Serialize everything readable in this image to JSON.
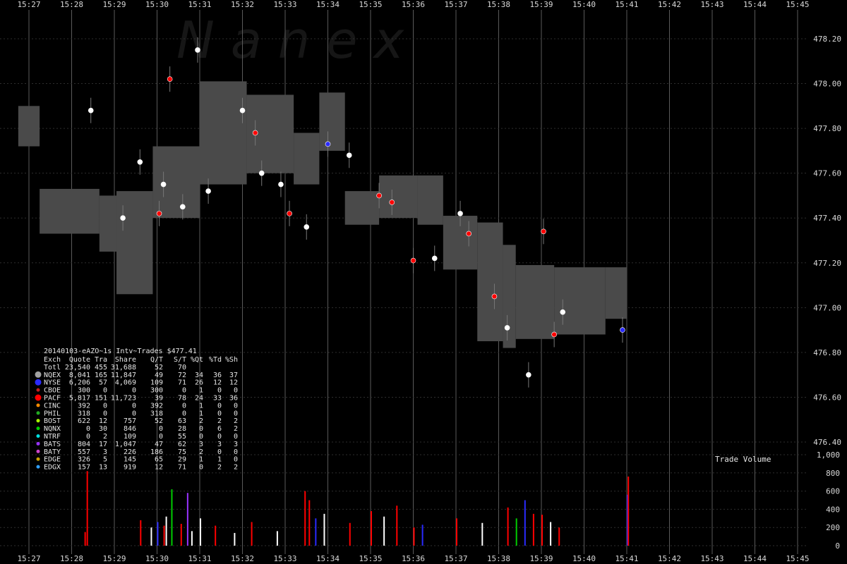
{
  "watermark": "N a n e x",
  "chart_data": {
    "type": "scatter",
    "title": "20140103-eAZO~1s Intv~Trades $477.41",
    "x_ticks": [
      "15:27",
      "15:28",
      "15:29",
      "15:30",
      "15:31",
      "15:32",
      "15:33",
      "15:34",
      "15:35",
      "15:36",
      "15:37",
      "15:38",
      "15:39",
      "15:40",
      "15:41",
      "15:42",
      "15:43",
      "15:44",
      "15:45"
    ],
    "y_ticks": [
      "478.20",
      "478.00",
      "477.80",
      "477.60",
      "477.40",
      "477.20",
      "477.00",
      "476.80",
      "476.60",
      "476.40"
    ],
    "ylim": [
      476.4,
      478.2
    ],
    "volume_label": "Trade Volume",
    "volume_ticks": [
      "1,000",
      "800",
      "600",
      "400",
      "200",
      "0"
    ],
    "volume_ylim": [
      0,
      1000
    ],
    "grid": true,
    "table_header": [
      "Exch",
      "Quote",
      "Tra",
      "Share",
      "Q/T",
      "S/T",
      "%Qt",
      "%Td",
      "%Sh"
    ],
    "table_rows": [
      {
        "exch": "Totl",
        "color": "",
        "quote": "23,540",
        "tra": "455",
        "share": "31,688",
        "qt": "52",
        "st": "70",
        "pq": "",
        "pt": "",
        "ps": ""
      },
      {
        "exch": "NQEX",
        "color": "#a0a0a0",
        "quote": "8,041",
        "tra": "165",
        "share": "11,847",
        "qt": "49",
        "st": "72",
        "pq": "34",
        "pt": "36",
        "ps": "37"
      },
      {
        "exch": "NYSE",
        "color": "#2a2aff",
        "quote": "6,206",
        "tra": "57",
        "share": "4,069",
        "qt": "109",
        "st": "71",
        "pq": "26",
        "pt": "12",
        "ps": "12"
      },
      {
        "exch": "CBOE",
        "color": "#c02020",
        "quote": "300",
        "tra": "0",
        "share": "0",
        "qt": "300",
        "st": "0",
        "pq": "1",
        "pt": "0",
        "ps": "0"
      },
      {
        "exch": "PACF",
        "color": "#ff0000",
        "quote": "5,817",
        "tra": "151",
        "share": "11,723",
        "qt": "39",
        "st": "78",
        "pq": "24",
        "pt": "33",
        "ps": "36"
      },
      {
        "exch": "CINC",
        "color": "#ff8c00",
        "quote": "392",
        "tra": "0",
        "share": "0",
        "qt": "392",
        "st": "0",
        "pq": "1",
        "pt": "0",
        "ps": "0"
      },
      {
        "exch": "PHIL",
        "color": "#22aa22",
        "quote": "318",
        "tra": "0",
        "share": "0",
        "qt": "318",
        "st": "0",
        "pq": "1",
        "pt": "0",
        "ps": "0"
      },
      {
        "exch": "BOST",
        "color": "#aaff00",
        "quote": "622",
        "tra": "12",
        "share": "757",
        "qt": "52",
        "st": "63",
        "pq": "2",
        "pt": "2",
        "ps": "2"
      },
      {
        "exch": "NQNX",
        "color": "#00cc00",
        "quote": "0",
        "tra": "30",
        "share": "846",
        "qt": "0",
        "st": "28",
        "pq": "0",
        "pt": "6",
        "ps": "2"
      },
      {
        "exch": "NTRF",
        "color": "#00e0e0",
        "quote": "0",
        "tra": "2",
        "share": "109",
        "qt": "0",
        "st": "55",
        "pq": "0",
        "pt": "0",
        "ps": "0"
      },
      {
        "exch": "BATS",
        "color": "#9933ff",
        "quote": "804",
        "tra": "17",
        "share": "1,047",
        "qt": "47",
        "st": "62",
        "pq": "3",
        "pt": "3",
        "ps": "3"
      },
      {
        "exch": "BATY",
        "color": "#cc44cc",
        "quote": "557",
        "tra": "3",
        "share": "226",
        "qt": "186",
        "st": "75",
        "pq": "2",
        "pt": "0",
        "ps": "0"
      },
      {
        "exch": "EDGE",
        "color": "#c8a000",
        "quote": "326",
        "tra": "5",
        "share": "145",
        "qt": "65",
        "st": "29",
        "pq": "1",
        "pt": "1",
        "ps": "0"
      },
      {
        "exch": "EDGX",
        "color": "#30a0ff",
        "quote": "157",
        "tra": "13",
        "share": "919",
        "qt": "12",
        "st": "71",
        "pq": "0",
        "pt": "2",
        "ps": "2"
      }
    ],
    "nbbo_bands": [
      {
        "t0": -0.25,
        "t1": 0.25,
        "hi": 477.9,
        "lo": 477.72
      },
      {
        "t0": 0.25,
        "t1": 1.65,
        "hi": 477.53,
        "lo": 477.33
      },
      {
        "t0": 1.65,
        "t1": 2.05,
        "hi": 477.5,
        "lo": 477.25
      },
      {
        "t0": 2.05,
        "t1": 2.9,
        "hi": 477.52,
        "lo": 477.06
      },
      {
        "t0": 2.9,
        "t1": 4.0,
        "hi": 477.72,
        "lo": 477.4
      },
      {
        "t0": 4.0,
        "t1": 5.1,
        "hi": 478.01,
        "lo": 477.55
      },
      {
        "t0": 5.1,
        "t1": 6.2,
        "hi": 477.95,
        "lo": 477.6
      },
      {
        "t0": 6.2,
        "t1": 6.8,
        "hi": 477.78,
        "lo": 477.55
      },
      {
        "t0": 6.8,
        "t1": 7.4,
        "hi": 477.96,
        "lo": 477.7
      },
      {
        "t0": 7.4,
        "t1": 8.2,
        "hi": 477.52,
        "lo": 477.37
      },
      {
        "t0": 8.2,
        "t1": 9.1,
        "hi": 477.59,
        "lo": 477.4
      },
      {
        "t0": 9.1,
        "t1": 9.7,
        "hi": 477.59,
        "lo": 477.37
      },
      {
        "t0": 9.7,
        "t1": 10.5,
        "hi": 477.41,
        "lo": 477.17
      },
      {
        "t0": 10.5,
        "t1": 11.1,
        "hi": 477.38,
        "lo": 476.85
      },
      {
        "t0": 11.1,
        "t1": 11.4,
        "hi": 477.28,
        "lo": 476.82
      },
      {
        "t0": 11.4,
        "t1": 12.3,
        "hi": 477.19,
        "lo": 476.86
      },
      {
        "t0": 12.3,
        "t1": 13.5,
        "hi": 477.18,
        "lo": 476.88
      },
      {
        "t0": 13.5,
        "t1": 14.0,
        "hi": 477.18,
        "lo": 476.95
      }
    ],
    "trades": [
      {
        "t": 1.45,
        "p": 477.88,
        "c": "#ffffff"
      },
      {
        "t": 2.2,
        "p": 477.4,
        "c": "#ffffff"
      },
      {
        "t": 2.6,
        "p": 477.65,
        "c": "#ffffff"
      },
      {
        "t": 3.05,
        "p": 477.42,
        "c": "#ff0000"
      },
      {
        "t": 3.15,
        "p": 477.55,
        "c": "#ffffff"
      },
      {
        "t": 3.3,
        "p": 478.02,
        "c": "#ff0000"
      },
      {
        "t": 3.6,
        "p": 477.45,
        "c": "#ffffff"
      },
      {
        "t": 3.95,
        "p": 478.15,
        "c": "#ffffff"
      },
      {
        "t": 4.2,
        "p": 477.52,
        "c": "#ffffff"
      },
      {
        "t": 5.0,
        "p": 477.88,
        "c": "#ffffff"
      },
      {
        "t": 5.3,
        "p": 477.78,
        "c": "#ff0000"
      },
      {
        "t": 5.45,
        "p": 477.6,
        "c": "#ffffff"
      },
      {
        "t": 5.9,
        "p": 477.55,
        "c": "#ffffff"
      },
      {
        "t": 6.1,
        "p": 477.42,
        "c": "#ff0000"
      },
      {
        "t": 6.5,
        "p": 477.36,
        "c": "#ffffff"
      },
      {
        "t": 7.0,
        "p": 477.73,
        "c": "#2a2aff"
      },
      {
        "t": 7.5,
        "p": 477.68,
        "c": "#ffffff"
      },
      {
        "t": 8.2,
        "p": 477.5,
        "c": "#ff0000"
      },
      {
        "t": 8.5,
        "p": 477.47,
        "c": "#ff0000"
      },
      {
        "t": 9.0,
        "p": 477.21,
        "c": "#ff0000"
      },
      {
        "t": 9.5,
        "p": 477.22,
        "c": "#ffffff"
      },
      {
        "t": 10.1,
        "p": 477.42,
        "c": "#ffffff"
      },
      {
        "t": 10.3,
        "p": 477.33,
        "c": "#ff0000"
      },
      {
        "t": 10.9,
        "p": 477.05,
        "c": "#ff0000"
      },
      {
        "t": 11.2,
        "p": 476.91,
        "c": "#ffffff"
      },
      {
        "t": 11.7,
        "p": 476.7,
        "c": "#ffffff"
      },
      {
        "t": 12.05,
        "p": 477.34,
        "c": "#ff0000"
      },
      {
        "t": 12.3,
        "p": 476.88,
        "c": "#ff0000"
      },
      {
        "t": 12.5,
        "p": 476.98,
        "c": "#ffffff"
      },
      {
        "t": 13.9,
        "p": 476.9,
        "c": "#2a2aff"
      }
    ],
    "volume_bars": [
      {
        "t": 1.3,
        "v": 150,
        "c": "#ff0000"
      },
      {
        "t": 1.35,
        "v": 820,
        "c": "#ff0000"
      },
      {
        "t": 2.6,
        "v": 280,
        "c": "#ff0000"
      },
      {
        "t": 2.85,
        "v": 200,
        "c": "#ffffff"
      },
      {
        "t": 3.0,
        "v": 260,
        "c": "#2a2aff"
      },
      {
        "t": 3.15,
        "v": 220,
        "c": "#ff0000"
      },
      {
        "t": 3.2,
        "v": 320,
        "c": "#ffffff"
      },
      {
        "t": 3.33,
        "v": 620,
        "c": "#00cc00"
      },
      {
        "t": 3.55,
        "v": 240,
        "c": "#ff0000"
      },
      {
        "t": 3.7,
        "v": 580,
        "c": "#9933ff"
      },
      {
        "t": 3.8,
        "v": 160,
        "c": "#ffffff"
      },
      {
        "t": 4.0,
        "v": 300,
        "c": "#ffffff"
      },
      {
        "t": 4.35,
        "v": 220,
        "c": "#ff0000"
      },
      {
        "t": 4.8,
        "v": 140,
        "c": "#ffffff"
      },
      {
        "t": 5.2,
        "v": 260,
        "c": "#ff0000"
      },
      {
        "t": 5.8,
        "v": 160,
        "c": "#ffffff"
      },
      {
        "t": 6.45,
        "v": 600,
        "c": "#ff0000"
      },
      {
        "t": 6.55,
        "v": 500,
        "c": "#ff0000"
      },
      {
        "t": 6.7,
        "v": 300,
        "c": "#2a2aff"
      },
      {
        "t": 6.9,
        "v": 350,
        "c": "#ffffff"
      },
      {
        "t": 7.5,
        "v": 250,
        "c": "#ff0000"
      },
      {
        "t": 8.0,
        "v": 380,
        "c": "#ff0000"
      },
      {
        "t": 8.3,
        "v": 320,
        "c": "#ffffff"
      },
      {
        "t": 8.6,
        "v": 440,
        "c": "#ff0000"
      },
      {
        "t": 9.0,
        "v": 200,
        "c": "#ff0000"
      },
      {
        "t": 9.2,
        "v": 230,
        "c": "#2a2aff"
      },
      {
        "t": 10.0,
        "v": 300,
        "c": "#ff0000"
      },
      {
        "t": 10.6,
        "v": 250,
        "c": "#ffffff"
      },
      {
        "t": 11.2,
        "v": 420,
        "c": "#ff0000"
      },
      {
        "t": 11.4,
        "v": 300,
        "c": "#00cc00"
      },
      {
        "t": 11.6,
        "v": 500,
        "c": "#2a2aff"
      },
      {
        "t": 11.8,
        "v": 350,
        "c": "#ff0000"
      },
      {
        "t": 12.0,
        "v": 340,
        "c": "#ff0000"
      },
      {
        "t": 12.2,
        "v": 260,
        "c": "#ffffff"
      },
      {
        "t": 12.4,
        "v": 200,
        "c": "#ff0000"
      },
      {
        "t": 14.0,
        "v": 560,
        "c": "#2a2aff"
      },
      {
        "t": 14.02,
        "v": 760,
        "c": "#ff0000"
      }
    ]
  }
}
